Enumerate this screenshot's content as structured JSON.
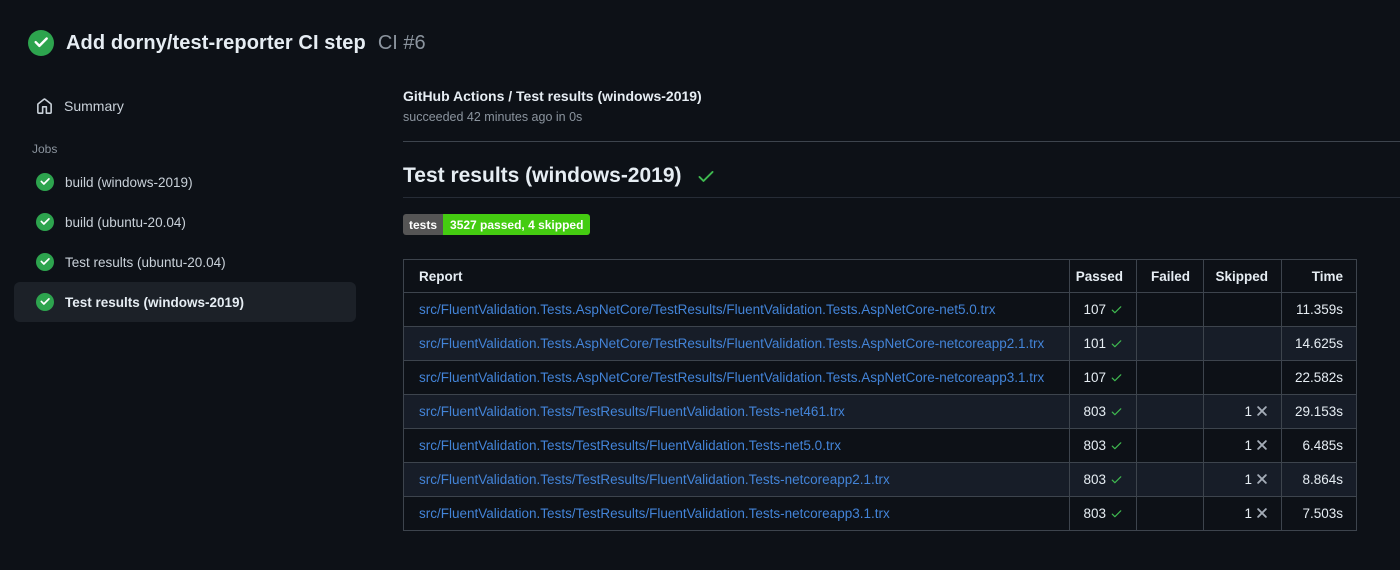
{
  "header": {
    "title": "Add dorny/test-reporter CI step",
    "run_number": "CI #6"
  },
  "sidebar": {
    "summary_label": "Summary",
    "jobs_label": "Jobs",
    "jobs": [
      {
        "label": "build (windows-2019)",
        "selected": false
      },
      {
        "label": "build (ubuntu-20.04)",
        "selected": false
      },
      {
        "label": "Test results (ubuntu-20.04)",
        "selected": false
      },
      {
        "label": "Test results (windows-2019)",
        "selected": true
      }
    ]
  },
  "check": {
    "name": "GitHub Actions / Test results (windows-2019)",
    "status_line": "succeeded 42 minutes ago in 0s",
    "heading": "Test results (windows-2019)",
    "badge": {
      "label": "tests",
      "value": "3527 passed, 4 skipped"
    }
  },
  "table": {
    "columns": [
      "Report",
      "Passed",
      "Failed",
      "Skipped",
      "Time"
    ],
    "rows": [
      {
        "report": "src/FluentValidation.Tests.AspNetCore/TestResults/FluentValidation.Tests.AspNetCore-net5.0.trx",
        "passed": "107",
        "failed": "",
        "skipped": "",
        "time": "11.359s"
      },
      {
        "report": "src/FluentValidation.Tests.AspNetCore/TestResults/FluentValidation.Tests.AspNetCore-netcoreapp2.1.trx",
        "passed": "101",
        "failed": "",
        "skipped": "",
        "time": "14.625s"
      },
      {
        "report": "src/FluentValidation.Tests.AspNetCore/TestResults/FluentValidation.Tests.AspNetCore-netcoreapp3.1.trx",
        "passed": "107",
        "failed": "",
        "skipped": "",
        "time": "22.582s"
      },
      {
        "report": "src/FluentValidation.Tests/TestResults/FluentValidation.Tests-net461.trx",
        "passed": "803",
        "failed": "",
        "skipped": "1",
        "time": "29.153s"
      },
      {
        "report": "src/FluentValidation.Tests/TestResults/FluentValidation.Tests-net5.0.trx",
        "passed": "803",
        "failed": "",
        "skipped": "1",
        "time": "6.485s"
      },
      {
        "report": "src/FluentValidation.Tests/TestResults/FluentValidation.Tests-netcoreapp2.1.trx",
        "passed": "803",
        "failed": "",
        "skipped": "1",
        "time": "8.864s"
      },
      {
        "report": "src/FluentValidation.Tests/TestResults/FluentValidation.Tests-netcoreapp3.1.trx",
        "passed": "803",
        "failed": "",
        "skipped": "1",
        "time": "7.503s"
      }
    ]
  },
  "icons": {
    "run_status": "check-circle-icon",
    "job_status": "check-circle-icon",
    "summary": "home-icon",
    "heading_status": "check-icon",
    "passed_cell": "check-icon",
    "skipped_cell": "x-icon"
  },
  "colors": {
    "page_bg": "#0d1117",
    "success_circle_green": "#2da44e",
    "check_green": "#3fb950",
    "link_blue": "#4384d8",
    "badge_label_bg": "#555555",
    "badge_value_bg": "#44cc11",
    "row_alt_bg": "#171d28",
    "table_border": "#3d444d",
    "muted_text": "#8b949e",
    "skipped_x_gray": "#a5adb8"
  }
}
